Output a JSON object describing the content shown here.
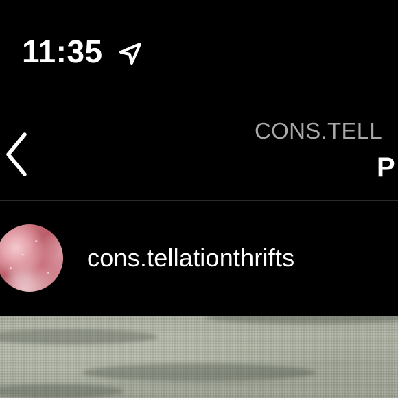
{
  "status_bar": {
    "time": "11:35",
    "location_icon": "location-arrow-icon"
  },
  "header": {
    "back_icon": "chevron-left-icon",
    "username_partial": "CONS.TELL",
    "title_partial": "P"
  },
  "post": {
    "author": "cons.tellationthrifts",
    "avatar_colors": [
      "#d98c97",
      "#b95d69",
      "#e2aab2"
    ],
    "image_color": "#a9ae9f"
  },
  "colors": {
    "background": "#000000",
    "text": "#ffffff",
    "secondary_text": "#a8a8a8",
    "divider": "#2a2a2a"
  }
}
